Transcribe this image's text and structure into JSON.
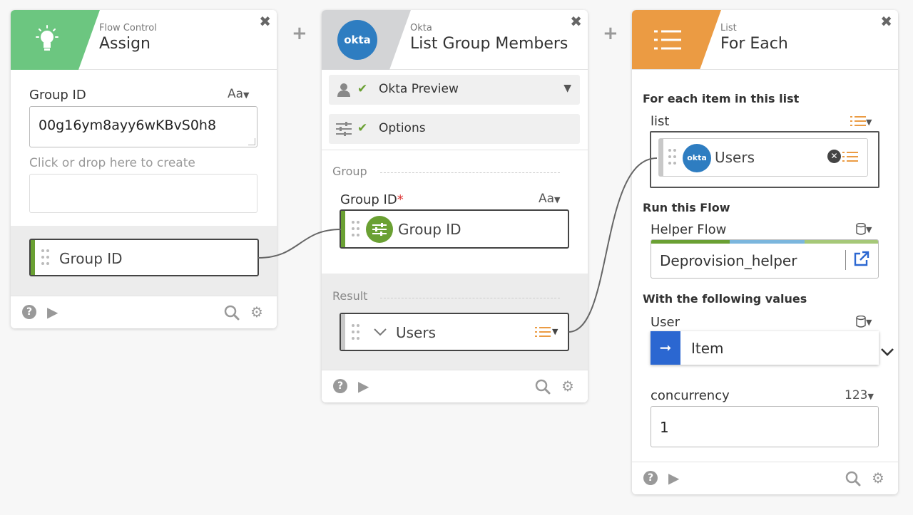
{
  "cards": {
    "assign": {
      "app": "Flow Control",
      "title": "Assign",
      "field_label": "Group ID",
      "field_type": "Aa",
      "field_value": "00g16ym8ayy6wKBvS0h8",
      "create_hint": "Click or drop here to create",
      "output_label": "Group ID"
    },
    "okta": {
      "app": "Okta",
      "title": "List Group Members",
      "logo_text": "okta",
      "connection": "Okta Preview",
      "options": "Options",
      "group_section": "Group",
      "input_label": "Group ID",
      "required_mark": "*",
      "input_type": "Aa",
      "input_pill": "Group ID",
      "result_section": "Result",
      "output_pill": "Users"
    },
    "foreach": {
      "app": "List",
      "title": "For Each",
      "section_list": "For each item in this list",
      "list_label": "list",
      "list_pill": "Users",
      "list_pill_logo": "okta",
      "section_run": "Run this Flow",
      "helper_label": "Helper Flow",
      "helper_value": "Deprovision_helper",
      "section_values": "With the following values",
      "user_label": "User",
      "user_value": "Item",
      "concurrency_label": "concurrency",
      "concurrency_type": "123",
      "concurrency_value": "1"
    }
  },
  "colors": {
    "assign_header": "#6cc680",
    "okta_header": "#d3d4d6",
    "foreach_header": "#eb9b43",
    "okta_blue": "#2e7dc1",
    "connector_green": "#6aa033",
    "list_orange": "#eb9b43",
    "item_blue": "#2b67d1",
    "check_green": "#6aa033"
  },
  "icons": {
    "assign": "lightbulb-icon",
    "list": "list-icon",
    "close": "close-icon",
    "help": "help-icon",
    "play": "play-icon",
    "search": "search-icon",
    "gear": "gear-icon",
    "user": "user-icon",
    "sliders": "sliders-icon",
    "check": "check-icon",
    "external": "external-link-icon"
  }
}
